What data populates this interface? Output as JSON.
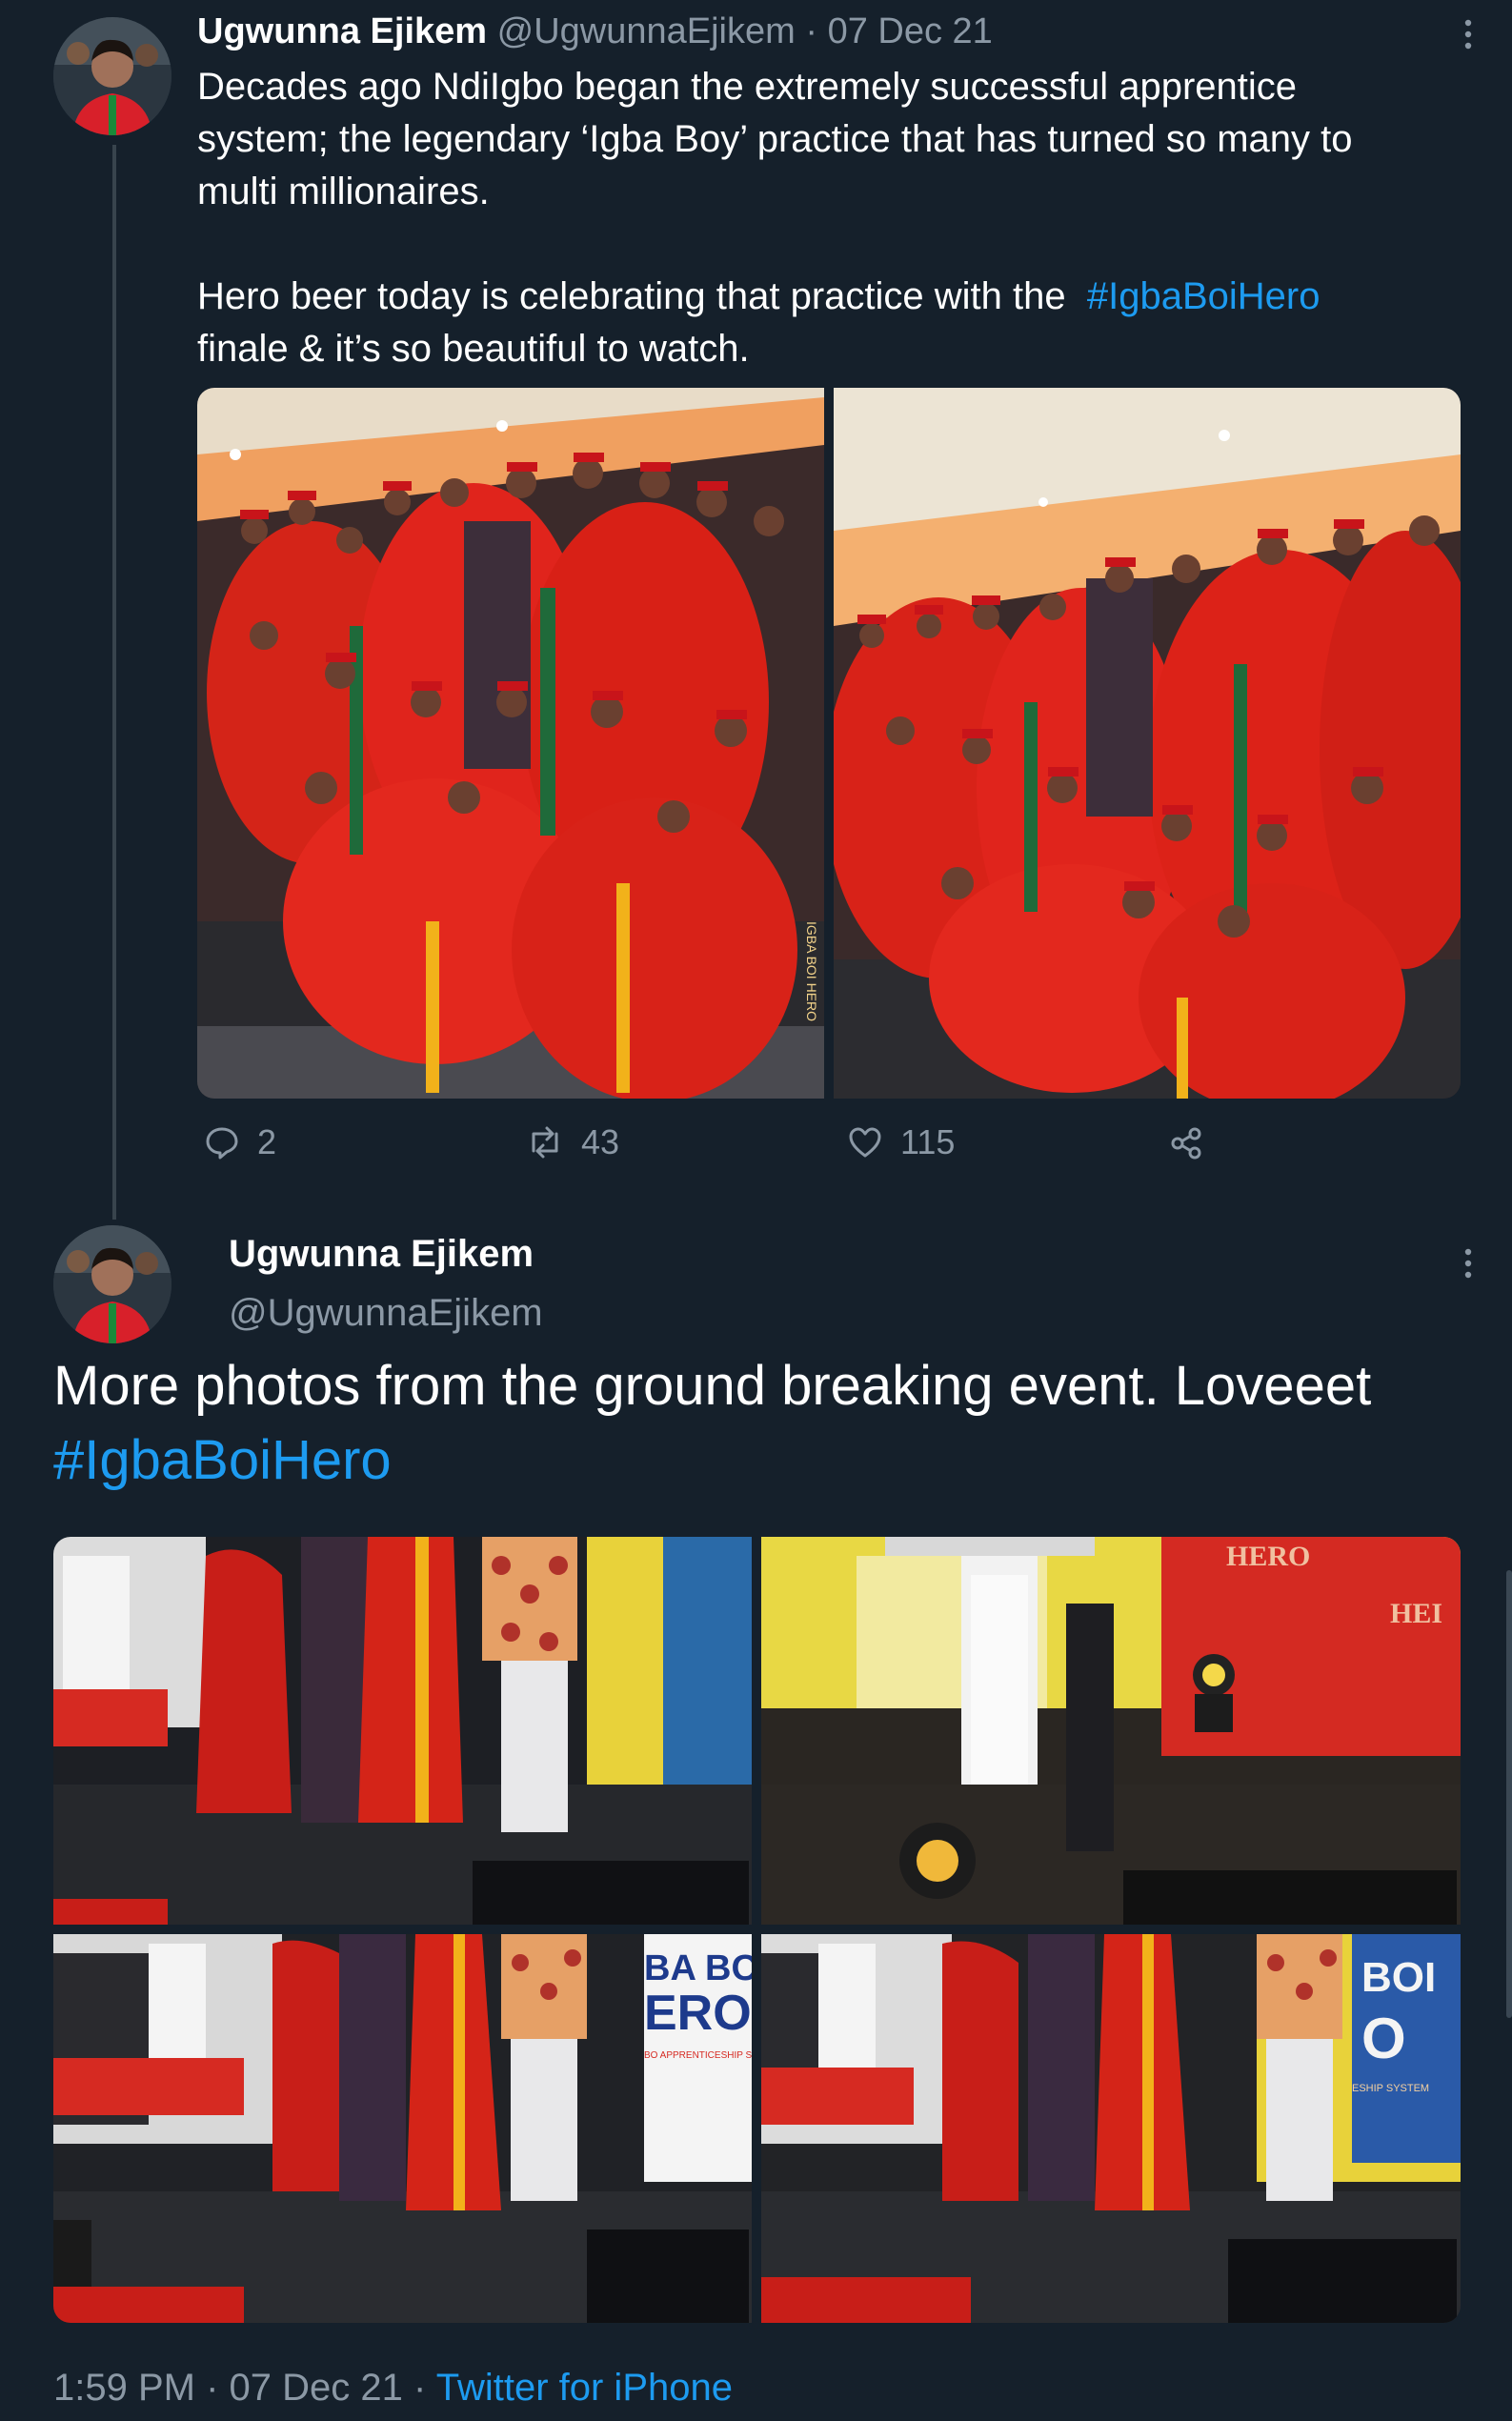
{
  "tweet1": {
    "author_name": "Ugwunna Ejikem",
    "author_handle": "@UgwunnaEjikem",
    "separator": "·",
    "date": "07 Dec 21",
    "text_line1": "Decades ago NdiIgbo began the extremely successful apprentice",
    "text_line2": "system; the legendary ‘Igba Boy’ practice that has turned so many to",
    "text_line3": "multi millionaires.",
    "text_line4_pre": "Hero beer today is celebrating that practice with the",
    "hashtag": "#IgbaBoiHero",
    "text_line5": "finale & it’s so beautiful to watch.",
    "replies": "2",
    "retweets": "43",
    "likes": "115"
  },
  "tweet2": {
    "author_name": "Ugwunna Ejikem",
    "author_handle": "@UgwunnaEjikem",
    "text_line1": "More photos from the ground breaking event. Loveeet",
    "hashtag": "#IgbaBoiHero",
    "time": "1:59 PM",
    "separator": "·",
    "date": "07 Dec 21",
    "separator2": "·",
    "source": "Twitter for iPhone"
  },
  "photo_text": {
    "sash1": "IGBA BOI HERO",
    "sign_tl": "HERO",
    "sign_tr": "HEI",
    "banner_bl_1": "BA BOI",
    "banner_bl_2": "ERO",
    "banner_bl_3": "BO APPRENTICESHIP SYSTEM",
    "banner_br_1": "BOI",
    "banner_br_2": "O",
    "banner_br_3": "ESHIP SYSTEM"
  },
  "colors": {
    "background": "#15202b",
    "muted": "#8b98a5",
    "link": "#1d9bf0",
    "gown_red": "#e0241c"
  },
  "icons": [
    "more-icon",
    "reply-icon",
    "retweet-icon",
    "like-icon",
    "share-icon"
  ]
}
